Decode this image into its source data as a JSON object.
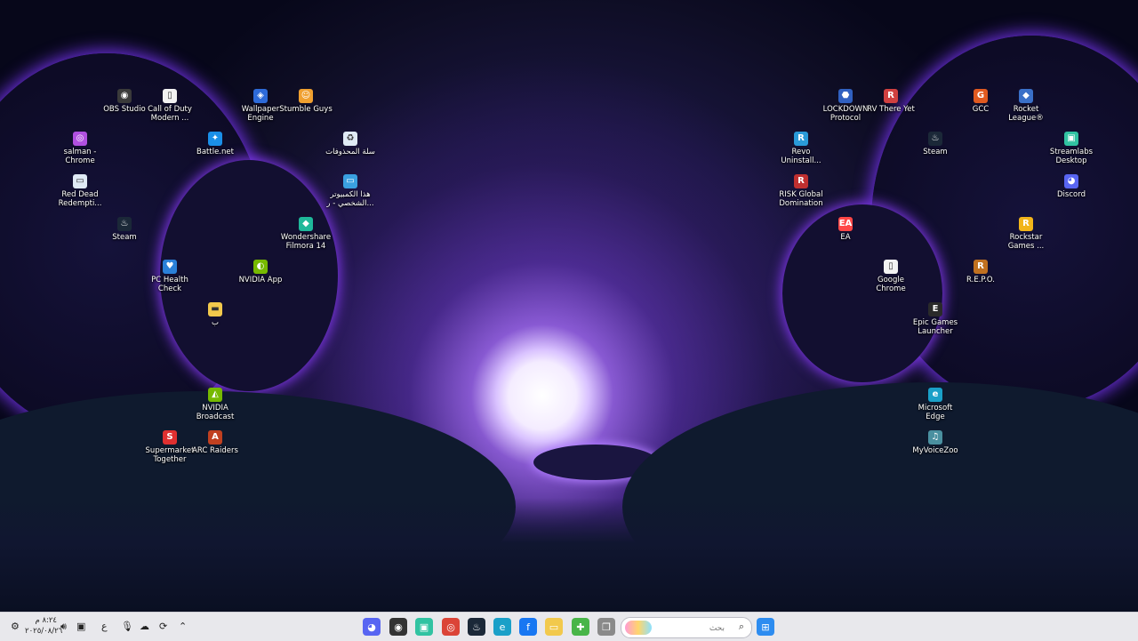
{
  "desktop": {
    "icons": [
      {
        "label": "OBS Studio",
        "icon": "obs-icon",
        "color": "#3a3a3a"
      },
      {
        "label": "Call of Duty Modern ...",
        "icon": "file-icon",
        "color": "#f2f2f2"
      },
      {
        "label": "Wallpaper Engine",
        "icon": "wallpaper-engine-icon",
        "color": "#2d6ad8"
      },
      {
        "label": "Stumble Guys",
        "icon": "stumble-guys-icon",
        "color": "#f0a030"
      },
      {
        "label": "salman - Chrome",
        "icon": "chrome-profile-icon",
        "color": "#b050e0"
      },
      {
        "label": "Battle.net",
        "icon": "battlenet-icon",
        "color": "#1a8fe8"
      },
      {
        "label": "سلة المحذوفات",
        "icon": "recycle-bin-icon",
        "color": "#dfeaf5"
      },
      {
        "label": "Red Dead Redempti...",
        "icon": "red-dead-icon",
        "color": "#dfeaf5"
      },
      {
        "label": "هذا الكمبيوتر الشخصي - ر...",
        "icon": "this-pc-icon",
        "color": "#3aa0e0"
      },
      {
        "label": "Steam",
        "icon": "steam-icon",
        "color": "#1b2838"
      },
      {
        "label": "Wondershare Filmora 14",
        "icon": "filmora-icon",
        "color": "#1fb89a"
      },
      {
        "label": "PC Health Check",
        "icon": "pc-health-check-icon",
        "color": "#2a80d8"
      },
      {
        "label": "NVIDIA App",
        "icon": "nvidia-icon",
        "color": "#76b900"
      },
      {
        "label": "ب",
        "icon": "folder-icon",
        "color": "#f2c94c"
      },
      {
        "label": "NVIDIA Broadcast",
        "icon": "nvidia-broadcast-icon",
        "color": "#76b900"
      },
      {
        "label": "Supermarket Together",
        "icon": "supermarket-together-icon",
        "color": "#e03030"
      },
      {
        "label": "ARC Raiders",
        "icon": "arc-raiders-icon",
        "color": "#c04020"
      },
      {
        "label": "LOCKDOWN Protocol",
        "icon": "lockdown-protocol-icon",
        "color": "#3060c0"
      },
      {
        "label": "RV There Yet",
        "icon": "rv-there-yet-icon",
        "color": "#d04040"
      },
      {
        "label": "GCC",
        "icon": "gcc-icon",
        "color": "#e05a20"
      },
      {
        "label": "Rocket League®",
        "icon": "rocket-league-icon",
        "color": "#3a70c8"
      },
      {
        "label": "Revo Uninstall...",
        "icon": "revo-uninstaller-icon",
        "color": "#2a9ad8"
      },
      {
        "label": "Steam",
        "icon": "steam-icon",
        "color": "#1b2838"
      },
      {
        "label": "Streamlabs Desktop",
        "icon": "streamlabs-icon",
        "color": "#31c3a2"
      },
      {
        "label": "RISK Global Domination",
        "icon": "risk-icon",
        "color": "#c03030"
      },
      {
        "label": "Discord",
        "icon": "discord-icon",
        "color": "#5865f2"
      },
      {
        "label": "EA",
        "icon": "ea-icon",
        "color": "#ff4747"
      },
      {
        "label": "Rockstar Games ...",
        "icon": "rockstar-icon",
        "color": "#f2b51a"
      },
      {
        "label": "Google Chrome",
        "icon": "file-icon",
        "color": "#f2f2f2"
      },
      {
        "label": "R.E.P.O.",
        "icon": "repo-icon",
        "color": "#c07020"
      },
      {
        "label": "Epic Games Launcher",
        "icon": "epic-games-icon",
        "color": "#2a2a2a"
      },
      {
        "label": "Microsoft Edge",
        "icon": "edge-icon",
        "color": "#1aa0c8"
      },
      {
        "label": "MyVoiceZoo",
        "icon": "myvoicezoo-icon",
        "color": "#4a90a0"
      }
    ]
  },
  "taskbar": {
    "clock": {
      "time": "٨:٢٤ م",
      "date": "٢٠٢٥/٠٨/٢٦"
    },
    "language": "ع",
    "search": {
      "placeholder": "بحث",
      "badge": "game-art-thumbnail"
    },
    "apps": [
      {
        "name": "discord-taskbar-icon",
        "color": "#5865f2",
        "glyph": "◕"
      },
      {
        "name": "obs-taskbar-icon",
        "color": "#333333",
        "glyph": "◉"
      },
      {
        "name": "streamlabs-taskbar-icon",
        "color": "#31c3a2",
        "glyph": "▣"
      },
      {
        "name": "chrome-taskbar-icon",
        "color": "#db4437",
        "glyph": "◎"
      },
      {
        "name": "steam-taskbar-icon",
        "color": "#1b2838",
        "glyph": "♨"
      },
      {
        "name": "edge-taskbar-icon",
        "color": "#1aa0c8",
        "glyph": "e"
      },
      {
        "name": "facebook-taskbar-icon",
        "color": "#1877f2",
        "glyph": "f"
      },
      {
        "name": "file-explorer-taskbar-icon",
        "color": "#f2c94c",
        "glyph": "▭"
      },
      {
        "name": "xbox-taskbar-icon",
        "color": "#48b548",
        "glyph": "✚"
      },
      {
        "name": "task-view-taskbar-icon",
        "color": "#8a8a8a",
        "glyph": "❐"
      },
      {
        "name": "start-taskbar-icon",
        "color": "#2d8cf0",
        "glyph": "⊞"
      }
    ]
  }
}
